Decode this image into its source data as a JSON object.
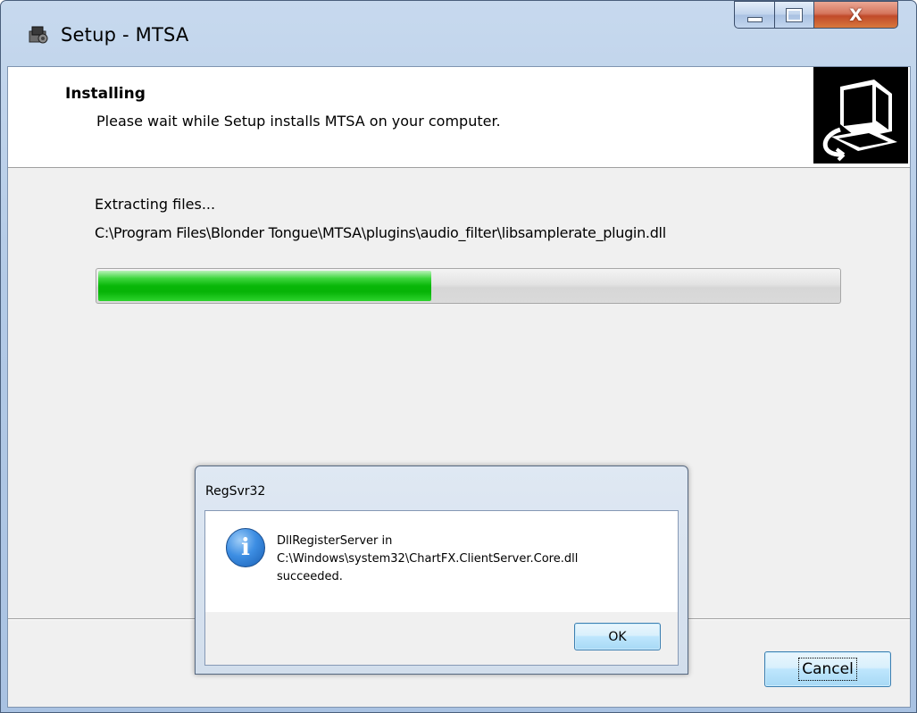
{
  "window": {
    "title": "Setup - MTSA",
    "controls": {
      "minimize": "minimize",
      "maximize": "maximize",
      "close_glyph": "X"
    }
  },
  "header": {
    "title": "Installing",
    "subtitle": "Please wait while Setup installs MTSA on your computer.",
    "image_icon": "computer-install-icon"
  },
  "status": {
    "text": "Extracting files...",
    "file_path": "C:\\Program Files\\Blonder Tongue\\MTSA\\plugins\\audio_filter\\libsamplerate_plugin.dll"
  },
  "progress": {
    "fraction": 0.45
  },
  "footer": {
    "cancel_label": "Cancel"
  },
  "dialog": {
    "title": "RegSvr32",
    "icon": "info-icon",
    "message_lines": [
      "DllRegisterServer in",
      "C:\\Windows\\system32\\ChartFX.ClientServer.Core.dll",
      "succeeded."
    ],
    "ok_label": "OK"
  },
  "colors": {
    "progress_green": "#09b709",
    "frame_blue": "#b3cae6",
    "close_red": "#c14a2a"
  }
}
